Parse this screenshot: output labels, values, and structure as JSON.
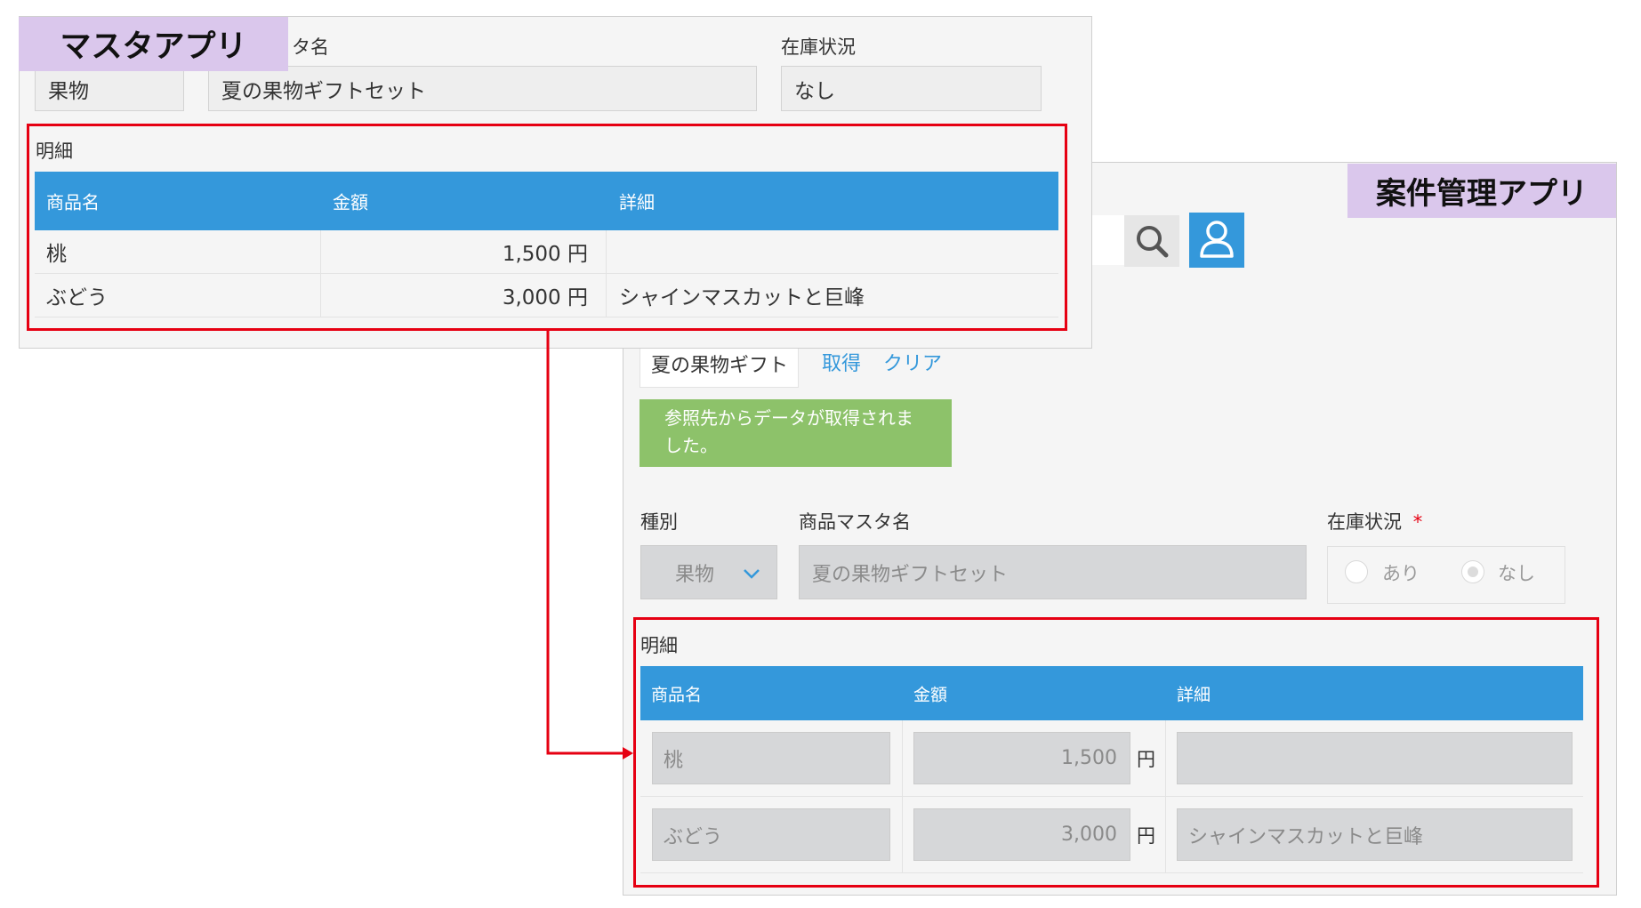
{
  "master_app": {
    "badge": "マスタアプリ",
    "labels": {
      "master_name": "タ名",
      "stock": "在庫状況"
    },
    "fields": {
      "category": "果物",
      "product_name": "夏の果物ギフトセット",
      "stock": "なし"
    },
    "detail": {
      "title": "明細",
      "columns": [
        "商品名",
        "金額",
        "詳細"
      ],
      "rows": [
        {
          "name": "桃",
          "amount": "1,500 円",
          "detail": ""
        },
        {
          "name": "ぶどう",
          "amount": "3,000 円",
          "detail": "シャインマスカットと巨峰"
        }
      ]
    }
  },
  "project_app": {
    "badge": "案件管理アプリ",
    "lookup": {
      "value": "夏の果物ギフト",
      "get_label": "取得",
      "clear_label": "クリア"
    },
    "notice": "参照先からデータが取得されました。",
    "labels": {
      "category": "種別",
      "master_name": "商品マスタ名",
      "stock": "在庫状況",
      "required_mark": "*"
    },
    "fields": {
      "category": "果物",
      "product_name": "夏の果物ギフトセット",
      "stock_options": [
        "あり",
        "なし"
      ]
    },
    "detail": {
      "title": "明細",
      "columns": [
        "商品名",
        "金額",
        "詳細"
      ],
      "currency": "円",
      "rows": [
        {
          "name": "桃",
          "amount": "1,500",
          "detail": ""
        },
        {
          "name": "ぶどう",
          "amount": "3,000",
          "detail": "シャインマスカットと巨峰"
        }
      ]
    }
  },
  "colors": {
    "accent_blue": "#3498db",
    "highlight_red": "#e60012",
    "badge_purple": "#dac7ec",
    "notice_green": "#8dc26a"
  }
}
